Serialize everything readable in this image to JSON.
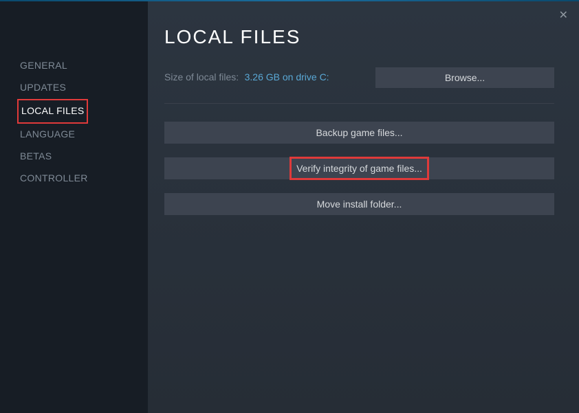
{
  "page": {
    "title": "LOCAL FILES"
  },
  "sidebar": {
    "items": [
      {
        "label": "GENERAL"
      },
      {
        "label": "UPDATES"
      },
      {
        "label": "LOCAL FILES"
      },
      {
        "label": "LANGUAGE"
      },
      {
        "label": "BETAS"
      },
      {
        "label": "CONTROLLER"
      }
    ]
  },
  "size": {
    "label": "Size of local files:",
    "value": "3.26 GB on drive C:"
  },
  "buttons": {
    "browse": "Browse...",
    "backup": "Backup game files...",
    "verify": "Verify integrity of game files...",
    "move": "Move install folder..."
  }
}
